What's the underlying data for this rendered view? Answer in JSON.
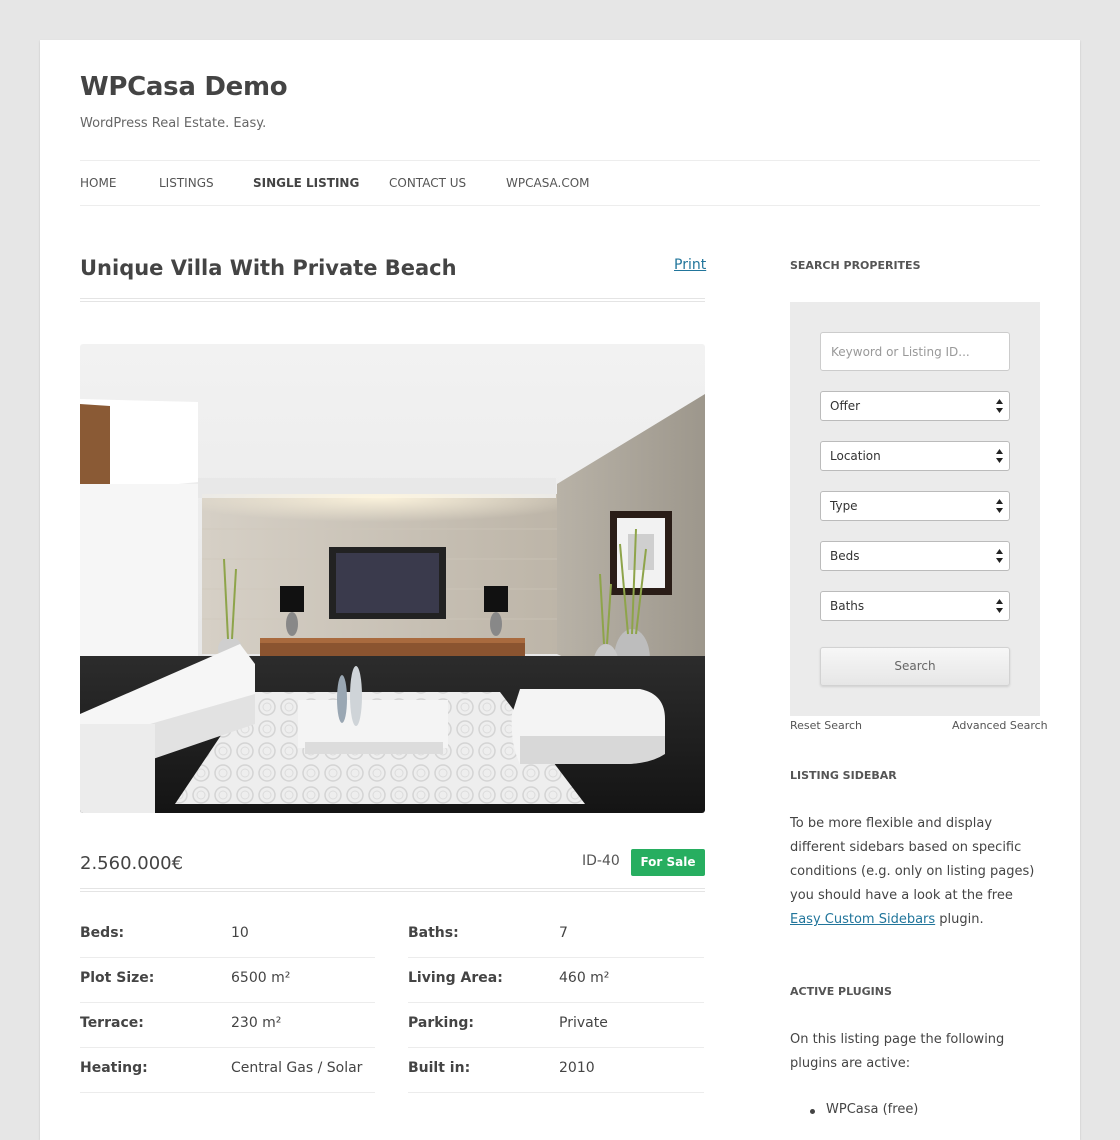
{
  "site": {
    "title": "WPCasa Demo",
    "tagline": "WordPress Real Estate. Easy."
  },
  "nav": {
    "items": [
      "HOME",
      "LISTINGS",
      "SINGLE LISTING",
      "CONTACT US",
      "WPCASA.COM"
    ],
    "active": "SINGLE LISTING"
  },
  "listing": {
    "title": "Unique Villa With Private Beach",
    "print_label": "Print",
    "price": "2.560.000€",
    "id": "ID-40",
    "status": "For Sale",
    "status_color": "#27ae60",
    "details": [
      {
        "label": "Beds:",
        "value": "10"
      },
      {
        "label": "Baths:",
        "value": "7"
      },
      {
        "label": "Plot Size:",
        "value": "6500 m²"
      },
      {
        "label": "Living Area:",
        "value": "460 m²"
      },
      {
        "label": "Terrace:",
        "value": "230 m²"
      },
      {
        "label": "Parking:",
        "value": "Private"
      },
      {
        "label": "Heating:",
        "value": "Central Gas / Solar"
      },
      {
        "label": "Built in:",
        "value": "2010"
      }
    ]
  },
  "sidebar": {
    "search": {
      "title": "SEARCH PROPERITES",
      "placeholder": "Keyword or Listing ID...",
      "selects": [
        "Offer",
        "Location",
        "Type",
        "Beds",
        "Baths"
      ],
      "button": "Search",
      "reset": "Reset Search",
      "advanced": "Advanced Search"
    },
    "listing_sidebar": {
      "title": "LISTING SIDEBAR",
      "text_before": "To be more flexible and display different sidebars based on specific conditions (e.g. only on listing pages) you should have a look at the free ",
      "link": "Easy Custom Sidebars",
      "text_after": " plugin."
    },
    "active_plugins": {
      "title": "ACTIVE PLUGINS",
      "text": "On this listing page the following plugins are active:",
      "items": [
        "WPCasa (free)"
      ]
    }
  },
  "colors": {
    "link": "#21759b",
    "badge": "#27ae60"
  }
}
